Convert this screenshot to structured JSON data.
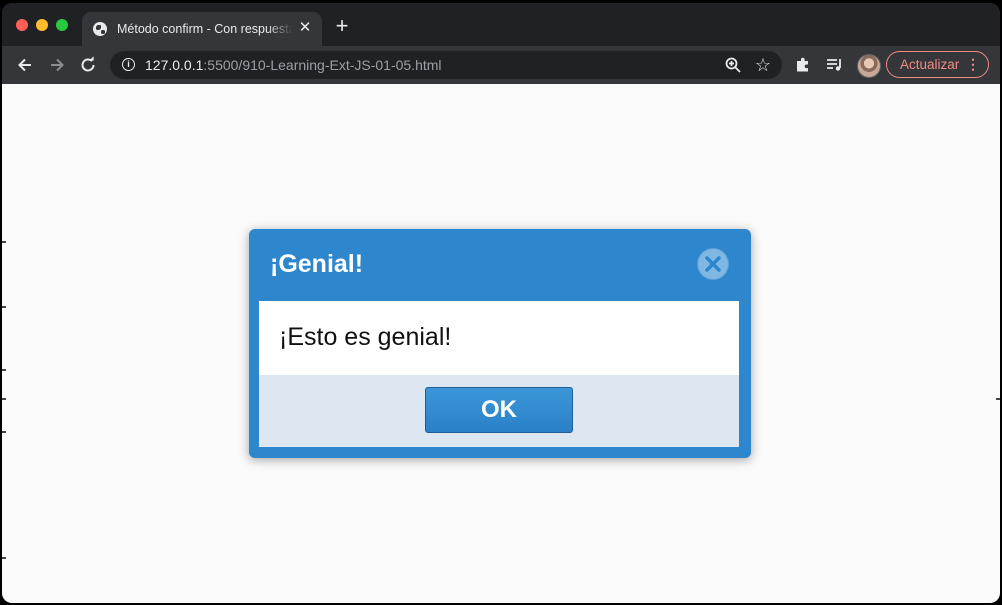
{
  "browser": {
    "tab": {
      "title": "Método confirm - Con respuesta"
    },
    "new_tab_symbol": "+",
    "address": {
      "host": "127.0.0.1",
      "path": ":5500/910-Learning-Ext-JS-01-05.html"
    },
    "update_button_label": "Actualizar",
    "icons": {
      "back": "arrow-left-icon",
      "forward": "arrow-right-icon",
      "reload": "reload-icon",
      "info": "info-icon",
      "zoom": "zoom-icon",
      "bookmark": "star-icon",
      "extensions": "puzzle-icon",
      "media": "media-queue-icon",
      "menu": "more-vertical-icon"
    },
    "colors": {
      "accent_update": "#f28b82"
    }
  },
  "dialog": {
    "title": "¡Genial!",
    "message": "¡Esto es genial!",
    "ok_label": "OK",
    "colors": {
      "frame": "#2e86cc",
      "footer": "#dce7f2",
      "button": "#2b80c8"
    }
  }
}
